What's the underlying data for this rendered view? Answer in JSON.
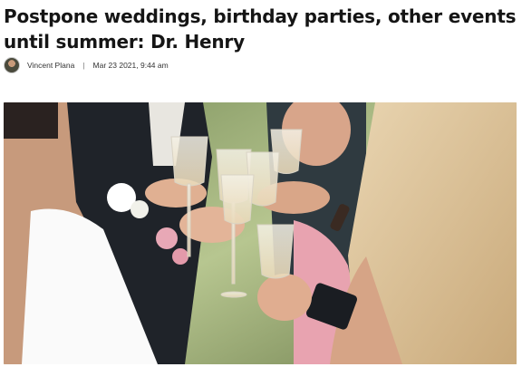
{
  "article": {
    "headline": "Postpone weddings, birthday parties, other events until summer: Dr. Henry",
    "author": "Vincent Plana",
    "separator": "|",
    "timestamp": "Mar 23 2021, 9:44 am"
  },
  "photo": {
    "subject": "champagne-toast-photo"
  },
  "colors": {
    "text": "#151515",
    "background": "#ffffff"
  }
}
